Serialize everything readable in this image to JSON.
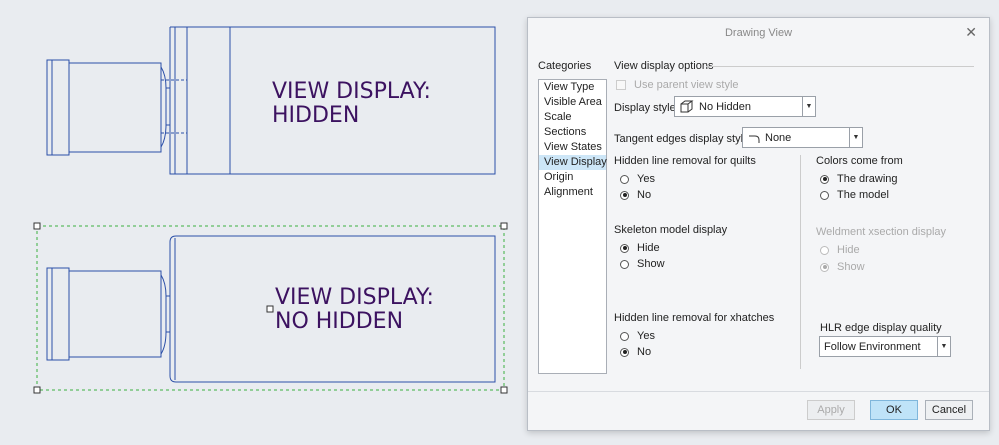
{
  "drawing": {
    "top_view_text": [
      "VIEW DISPLAY:",
      "HIDDEN"
    ],
    "bottom_view_text": [
      "VIEW DISPLAY:",
      "NO HIDDEN"
    ]
  },
  "dialog": {
    "title": "Drawing View",
    "categories_label": "Categories",
    "categories": [
      "View Type",
      "Visible Area",
      "Scale",
      "Sections",
      "View States",
      "View Display",
      "Origin",
      "Alignment"
    ],
    "selected_category": "View Display",
    "section_title": "View display options",
    "use_parent_view_style": "Use parent view style",
    "display_style_label": "Display style",
    "display_style_value": "No Hidden",
    "tangent_edges_label": "Tangent edges display style",
    "tangent_edges_value": "None",
    "hlr_quilts": {
      "label": "Hidden line removal for quilts",
      "options": [
        "Yes",
        "No"
      ],
      "selected": "No"
    },
    "skeleton": {
      "label": "Skeleton model display",
      "options": [
        "Hide",
        "Show"
      ],
      "selected": "Hide"
    },
    "hlr_xhatches": {
      "label": "Hidden line removal for xhatches",
      "options": [
        "Yes",
        "No"
      ],
      "selected": "No"
    },
    "colors": {
      "label": "Colors come from",
      "options": [
        "The drawing",
        "The model"
      ],
      "selected": "The drawing"
    },
    "weldment": {
      "label": "Weldment xsection display",
      "options": [
        "Hide",
        "Show"
      ],
      "selected": "Show"
    },
    "hlr_quality_label": "HLR edge display quality",
    "hlr_quality_value": "Follow Environment",
    "buttons": {
      "apply": "Apply",
      "ok": "OK",
      "cancel": "Cancel"
    }
  }
}
